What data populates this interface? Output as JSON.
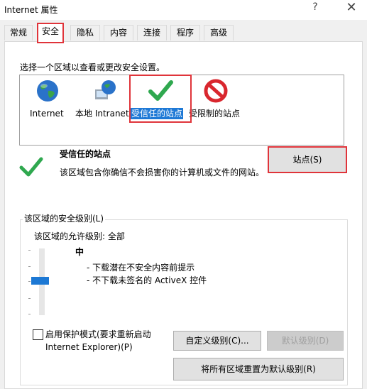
{
  "window": {
    "title": "Internet 属性",
    "help_glyph": "?",
    "close_glyph": "✕"
  },
  "tabs": [
    "常规",
    "安全",
    "隐私",
    "内容",
    "连接",
    "程序",
    "高级"
  ],
  "active_tab": "安全",
  "zones": {
    "prompt": "选择一个区域以查看或更改安全设置。",
    "items": [
      {
        "label": "Internet",
        "icon": "globe-icon"
      },
      {
        "label": "本地 Intranet",
        "icon": "intranet-globe-icon"
      },
      {
        "label": "受信任的站点",
        "icon": "checkmark-icon",
        "selected": true
      },
      {
        "label": "受限制的站点",
        "icon": "restricted-icon"
      }
    ]
  },
  "zone_detail": {
    "title": "受信任的站点",
    "description": "该区域包含你确信不会损害你的计算机或文件的网站。",
    "sites_button": "站点(S)"
  },
  "security_level": {
    "legend": "该区域的安全级别(L)",
    "allowed": "该区域的允许级别: 全部",
    "level_name": "中",
    "bullets": [
      "- 下载潜在不安全内容前提示",
      "- 不下载未签名的 ActiveX 控件"
    ],
    "protected_mode_label_1": "启用保护模式(要求重新启动",
    "protected_mode_label_2": "Internet Explorer)(P)",
    "protected_mode_checked": false,
    "custom_button": "自定义级别(C)...",
    "default_button": "默认级别(D)",
    "reset_all_button": "将所有区域重置为默认级别(R)"
  },
  "colors": {
    "accent": "#1c78d4",
    "highlight_red": "#e0343a",
    "check_green": "#2fa84f",
    "restricted_red": "#d9272e"
  }
}
